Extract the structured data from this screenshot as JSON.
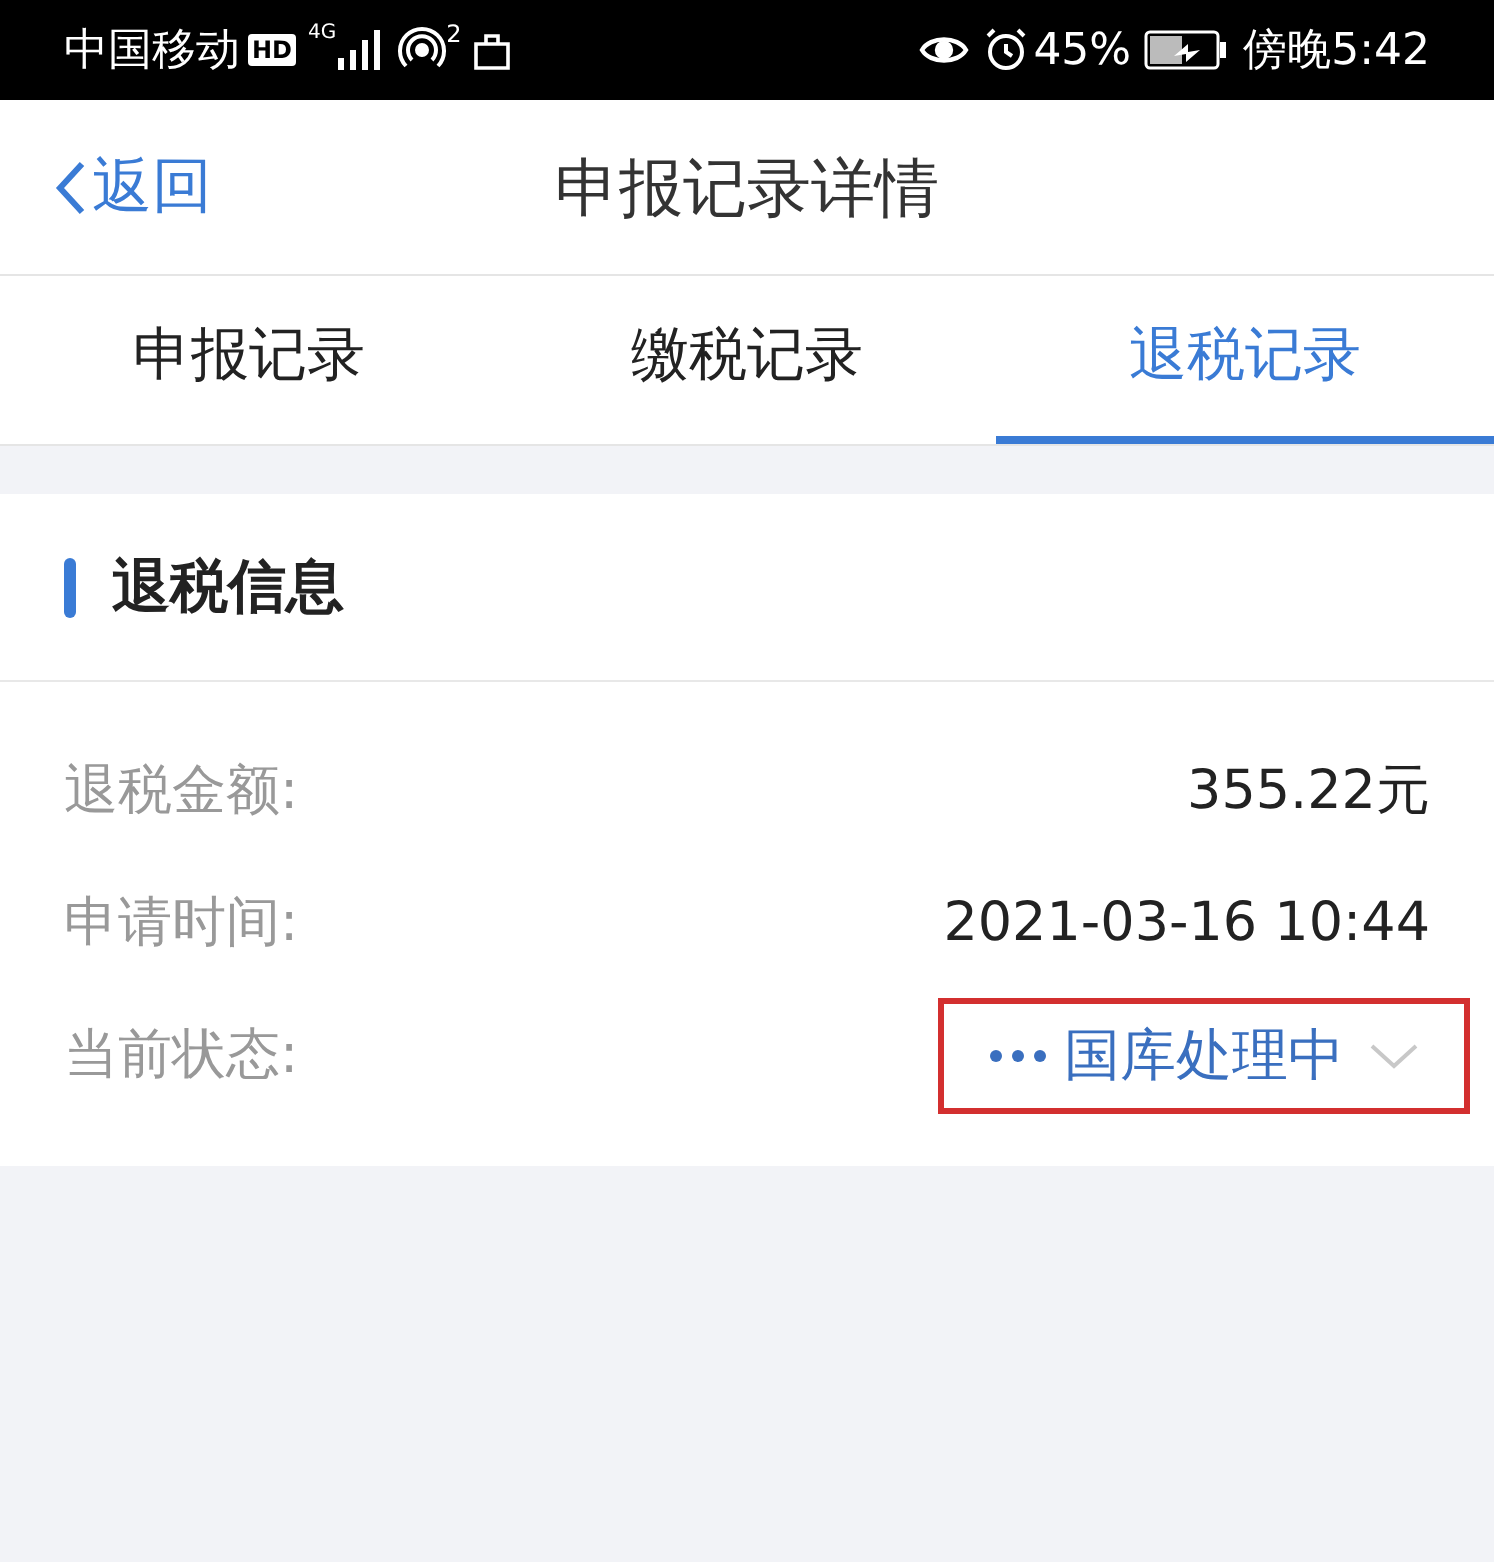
{
  "status_bar": {
    "carrier": "中国移动",
    "hd_badge": "HD",
    "network": "4G",
    "hotspot_count": "2",
    "battery": "45%",
    "time": "傍晚5:42"
  },
  "header": {
    "back": "返回",
    "title": "申报记录详情"
  },
  "tabs": [
    {
      "label": "申报记录",
      "selected": false
    },
    {
      "label": "缴税记录",
      "selected": false
    },
    {
      "label": "退税记录",
      "selected": true
    }
  ],
  "section": {
    "title": "退税信息",
    "rows": [
      {
        "label": "退税金额:",
        "value": "355.22元",
        "kind": "text",
        "highlighted": false
      },
      {
        "label": "申请时间:",
        "value": "2021-03-16 10:44",
        "kind": "text",
        "highlighted": false
      },
      {
        "label": "当前状态:",
        "value": "国库处理中",
        "kind": "status",
        "highlighted": true
      }
    ]
  }
}
